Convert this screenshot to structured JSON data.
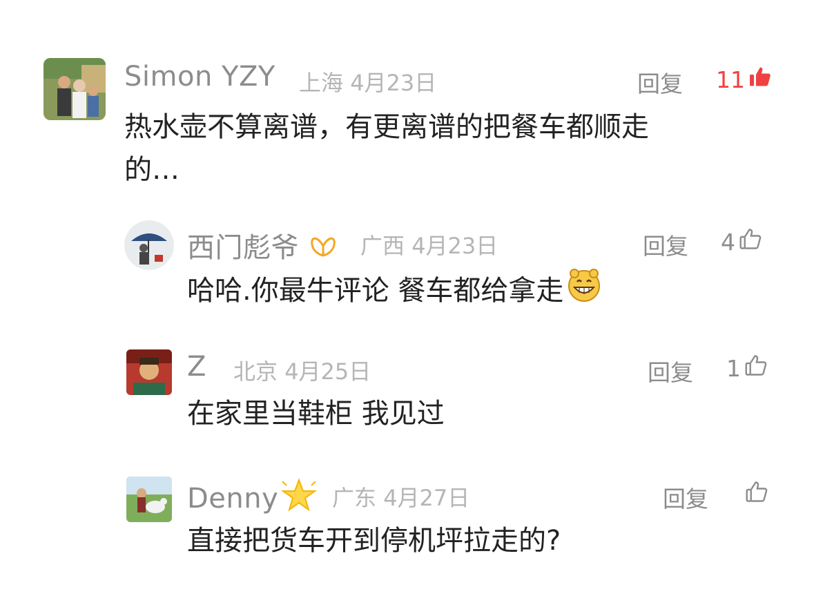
{
  "comments": [
    {
      "name": "Simon YZY",
      "location": "上海",
      "date": "4月23日",
      "reply_label": "回复",
      "likes": "11",
      "text_line1": "热水壶不算离谱，有更离谱的把餐车都顺走",
      "text_line2": "的…"
    },
    {
      "name": "西门彪爷",
      "location": "广西",
      "date": "4月23日",
      "reply_label": "回复",
      "likes": "4",
      "text": "哈哈.你最牛评论 餐车都给拿走"
    },
    {
      "name": "Z",
      "location": "北京",
      "date": "4月25日",
      "reply_label": "回复",
      "likes": "1",
      "text": "在家里当鞋柜 我见过"
    },
    {
      "name": "Denny",
      "location": "广东",
      "date": "4月27日",
      "reply_label": "回复",
      "likes": "",
      "text": "直接把货车开到停机坪拉走的?"
    }
  ],
  "colors": {
    "like_active": "#f04142",
    "name_gray": "#8c8c8c",
    "meta_gray": "#b5b5b5",
    "text_dark": "#222222"
  },
  "icons": {
    "like_filled": "thumbs-up-filled-icon",
    "like_outline": "thumbs-up-outline-icon",
    "vip_badge": "vip-wings-icon",
    "star_badge": "star-badge-icon",
    "emoji": "grinning-face-emoji"
  }
}
